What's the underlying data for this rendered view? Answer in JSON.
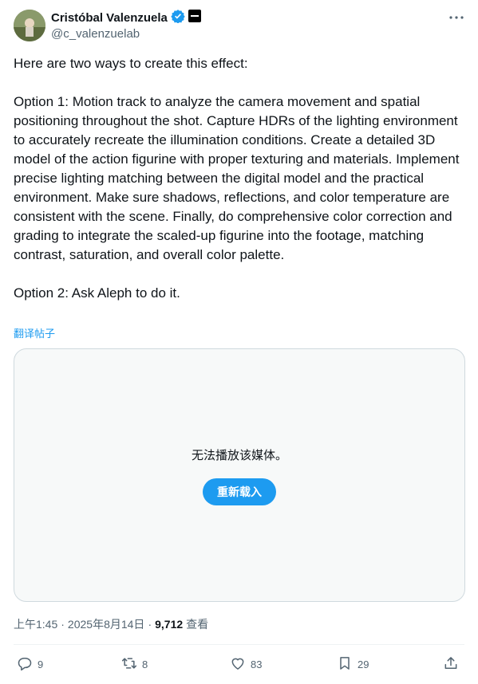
{
  "author": {
    "name": "Cristóbal Valenzuela",
    "handle": "@c_valenzuelab"
  },
  "tweet": {
    "paragraphs": [
      "Here are two ways to create this effect:",
      "Option 1: Motion track to analyze the camera movement and spatial positioning throughout the shot. Capture HDRs of the lighting environment to accurately recreate the illumination conditions. Create a detailed 3D model of the action figurine with proper texturing and materials. Implement precise lighting matching between the digital model and the practical environment. Make sure shadows, reflections, and color temperature are consistent with the scene. Finally, do comprehensive color correction and grading to integrate the scaled-up figurine into the footage, matching contrast, saturation, and overall color palette.",
      "Option 2: Ask Aleph to do it."
    ],
    "translate_label": "翻译帖子"
  },
  "media": {
    "message": "无法播放该媒体。",
    "reload_label": "重新载入"
  },
  "meta": {
    "time": "上午1:45",
    "date": "2025年8月14日",
    "views": "9,712",
    "views_label": "查看"
  },
  "actions": {
    "replies": "9",
    "reposts": "8",
    "likes": "83",
    "bookmarks": "29"
  },
  "colors": {
    "accent": "#1d9bf0",
    "muted": "#536471",
    "verified": "#1d9bf0"
  },
  "icons": [
    "verified-badge-icon",
    "affiliate-badge-icon",
    "more-icon",
    "reply-icon",
    "repost-icon",
    "like-icon",
    "bookmark-icon",
    "share-icon"
  ]
}
